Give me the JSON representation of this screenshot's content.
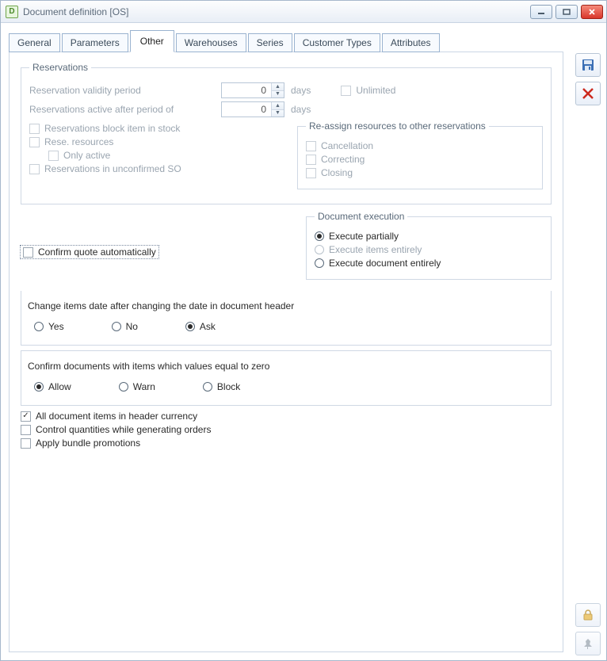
{
  "window": {
    "title": "Document definition [OS]",
    "icon_letter": "D"
  },
  "tabs": [
    "General",
    "Parameters",
    "Other",
    "Warehouses",
    "Series",
    "Customer Types",
    "Attributes"
  ],
  "active_tab": "Other",
  "reservations": {
    "legend": "Reservations",
    "validity_label": "Reservation validity period",
    "validity_value": "0",
    "validity_unit": "days",
    "unlimited_label": "Unlimited",
    "active_after_label": "Reservations active after period of",
    "active_after_value": "0",
    "active_after_unit": "days",
    "block_stock_label": "Reservations block item in stock",
    "rese_resources_label": "Rese. resources",
    "only_active_label": "Only active",
    "unconfirmed_so_label": "Reservations in unconfirmed SO",
    "reassign": {
      "legend": "Re-assign resources to other reservations",
      "cancellation": "Cancellation",
      "correcting": "Correcting",
      "closing": "Closing"
    }
  },
  "doc_exec": {
    "legend": "Document execution",
    "partial": "Execute partially",
    "items_entirely": "Execute items entirely",
    "doc_entirely": "Execute document entirely"
  },
  "confirm_quote": "Confirm quote automatically",
  "change_date": {
    "label": "Change items date after changing the date in document header",
    "yes": "Yes",
    "no": "No",
    "ask": "Ask"
  },
  "confirm_zero": {
    "label": "Confirm documents with items which values equal to zero",
    "allow": "Allow",
    "warn": "Warn",
    "block": "Block"
  },
  "all_items_currency": "All document items in header currency",
  "control_quantities": "Control quantities while generating orders",
  "apply_bundle": "Apply bundle promotions"
}
